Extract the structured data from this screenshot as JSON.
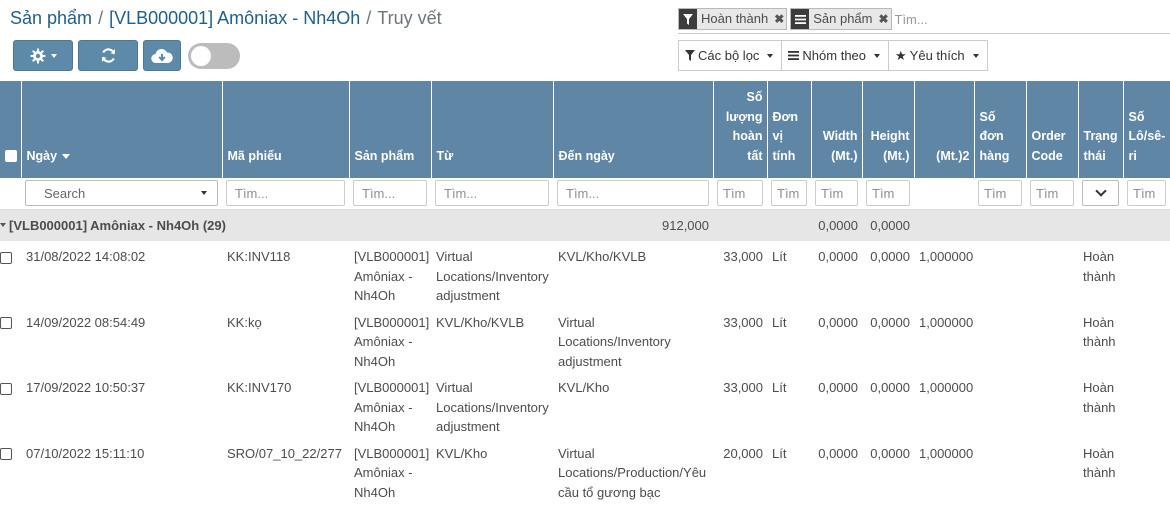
{
  "breadcrumb": {
    "items": [
      "Sản phẩm",
      "[VLB000001] Amôniax - Nh4Oh",
      "Truy vết"
    ],
    "separator": "/"
  },
  "toolbar": {
    "gear_icon": "gear-icon",
    "refresh_icon": "refresh-icon",
    "download_icon": "cloud-download-icon",
    "toggle_state": "off"
  },
  "search": {
    "facets": [
      {
        "icon": "filter-icon",
        "value": "Hoàn thành"
      },
      {
        "icon": "group-list-icon",
        "value": "Sản phẩm"
      }
    ],
    "placeholder": "Tìm..."
  },
  "filters": {
    "filters_label": "Các bộ lọc",
    "groupby_label": "Nhóm theo",
    "favorites_label": "Yêu thích"
  },
  "columns": [
    "Ngày",
    "Mã phiếu",
    "Sản phẩm",
    "Từ",
    "Đến ngày",
    "Số lượng hoàn tất",
    "Đơn vị tính",
    "Width (Mt.)",
    "Height (Mt.)",
    "(Mt.)2",
    "Số đơn hàng",
    "Order Code",
    "Trạng thái",
    "Số Lô/sê-ri"
  ],
  "filter_row": {
    "date_select": "Search",
    "placeholder": "Tìm...",
    "short_placeholder": "Tìm"
  },
  "group": {
    "label": "[VLB000001] Amôniax - Nh4Oh (29)",
    "qty": "912,000",
    "width": "0,0000",
    "height": "0,0000"
  },
  "rows": [
    {
      "date": "31/08/2022 14:08:02",
      "ref": "KK:INV118",
      "product": "[VLB000001] Amôniax - Nh4Oh",
      "from": "Virtual Locations/Inventory adjustment",
      "to": "KVL/Kho/KVLB",
      "qty": "33,000",
      "uom": "Lít",
      "width": "0,0000",
      "height": "0,0000",
      "m2": "1,000000",
      "state": "Hoàn thành"
    },
    {
      "date": "14/09/2022 08:54:49",
      "ref": "KK:kọ",
      "product": "[VLB000001] Amôniax - Nh4Oh",
      "from": "KVL/Kho/KVLB",
      "to": "Virtual Locations/Inventory adjustment",
      "qty": "33,000",
      "uom": "Lít",
      "width": "0,0000",
      "height": "0,0000",
      "m2": "1,000000",
      "state": "Hoàn thành"
    },
    {
      "date": "17/09/2022 10:50:37",
      "ref": "KK:INV170",
      "product": "[VLB000001] Amôniax - Nh4Oh",
      "from": "Virtual Locations/Inventory adjustment",
      "to": "KVL/Kho",
      "qty": "33,000",
      "uom": "Lít",
      "width": "0,0000",
      "height": "0,0000",
      "m2": "1,000000",
      "state": "Hoàn thành"
    },
    {
      "date": "07/10/2022 15:11:10",
      "ref": "SRO/07_10_22/277",
      "product": "[VLB000001] Amôniax - Nh4Oh",
      "from": "KVL/Kho",
      "to": "Virtual Locations/Production/Yêu cầu tổ gương bạc",
      "qty": "20,000",
      "uom": "Lít",
      "width": "0,0000",
      "height": "0,0000",
      "m2": "1,000000",
      "state": "Hoàn thành"
    }
  ]
}
